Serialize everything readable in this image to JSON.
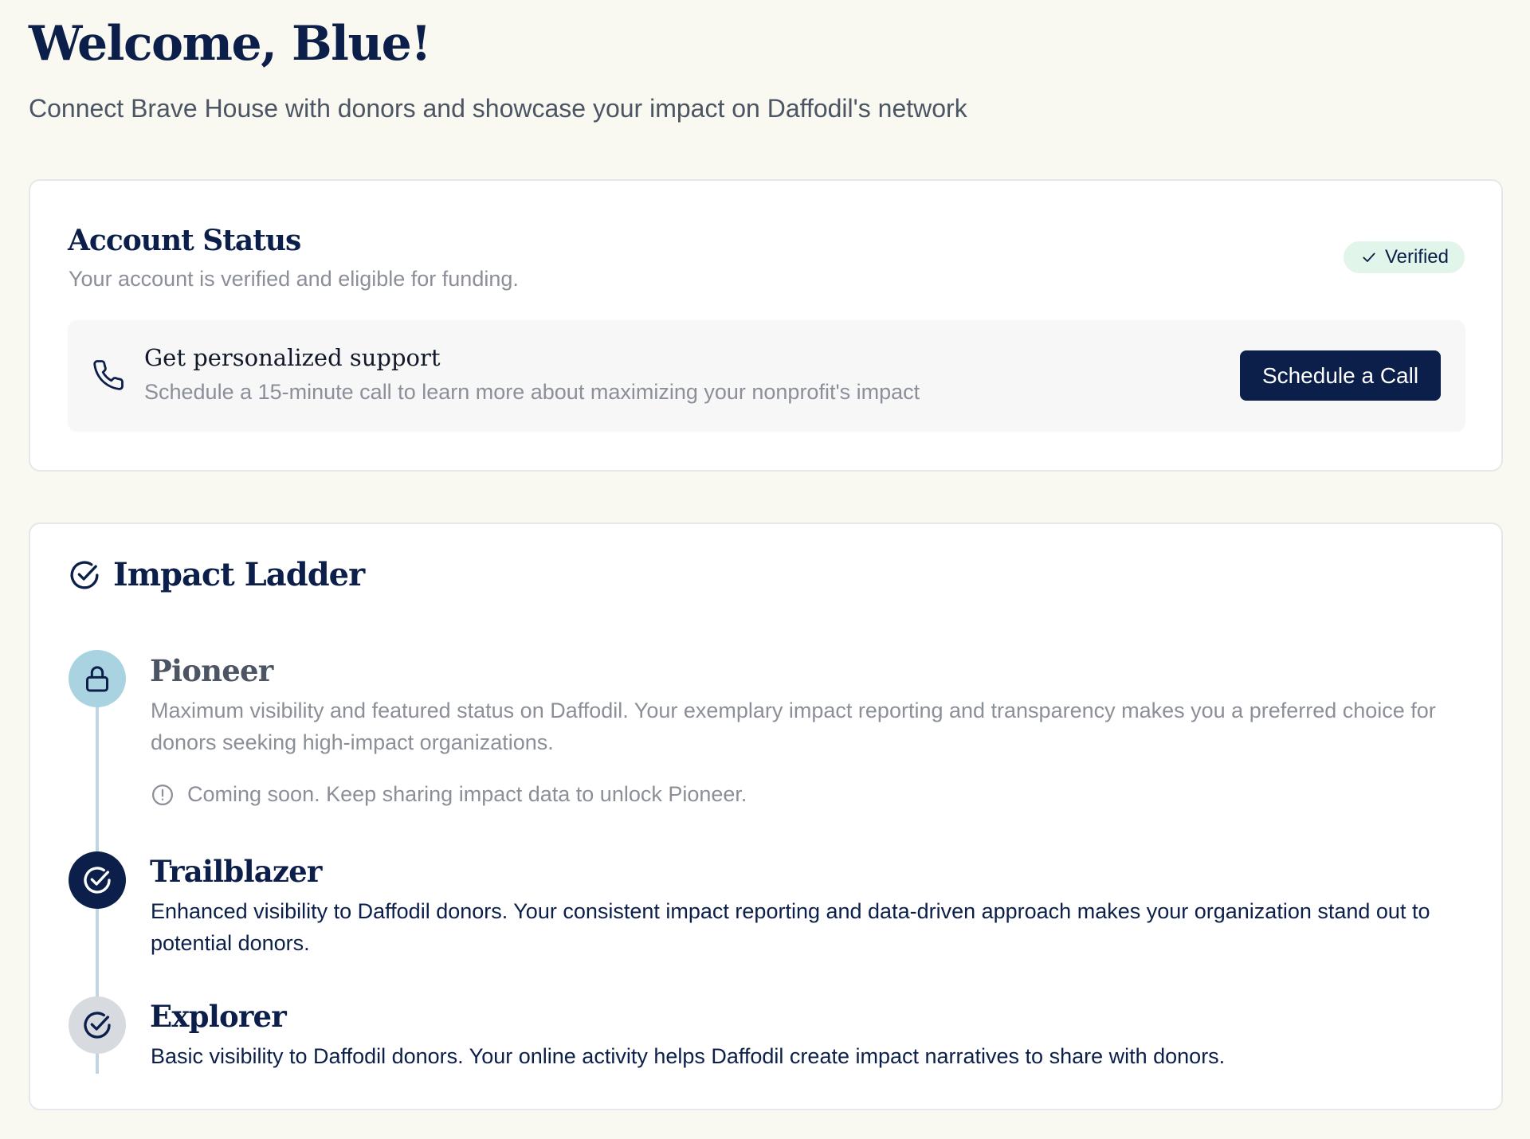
{
  "header": {
    "welcome": "Welcome, Blue!",
    "subtitle": "Connect Brave House with donors and showcase your impact on Daffodil's network"
  },
  "account_status": {
    "title": "Account Status",
    "subtitle": "Your account is verified and eligible for funding.",
    "badge": "Verified",
    "badge_icon": "check-icon",
    "support": {
      "icon": "phone-icon",
      "title": "Get personalized support",
      "subtitle": "Schedule a 15-minute call to learn more about maximizing your nonprofit's impact",
      "button_label": "Schedule a Call"
    }
  },
  "impact_ladder": {
    "title": "Impact Ladder",
    "title_icon": "circle-check-icon",
    "levels": [
      {
        "name": "Pioneer",
        "icon": "lock-icon",
        "state": "locked",
        "description": "Maximum visibility and featured status on Daffodil. Your exemplary impact reporting and transparency makes you a preferred choice for donors seeking high-impact organizations.",
        "note": "Coming soon. Keep sharing impact data to unlock Pioneer.",
        "note_icon": "info-circle-icon"
      },
      {
        "name": "Trailblazer",
        "icon": "circle-check-icon",
        "state": "current",
        "description": "Enhanced visibility to Daffodil donors. Your consistent impact reporting and data-driven approach makes your organization stand out to potential donors."
      },
      {
        "name": "Explorer",
        "icon": "circle-check-icon",
        "state": "achieved",
        "description": "Basic visibility to Daffodil donors. Your online activity helps Daffodil create impact narratives to share with donors."
      }
    ]
  },
  "colors": {
    "navy": "#0b1f4a",
    "background": "#f9f8f1",
    "verified_badge_bg": "#e1f5ea",
    "pioneer_icon_bg": "#a9d3e0",
    "explorer_icon_bg": "#d7dade",
    "timeline": "#bfd5e3"
  }
}
